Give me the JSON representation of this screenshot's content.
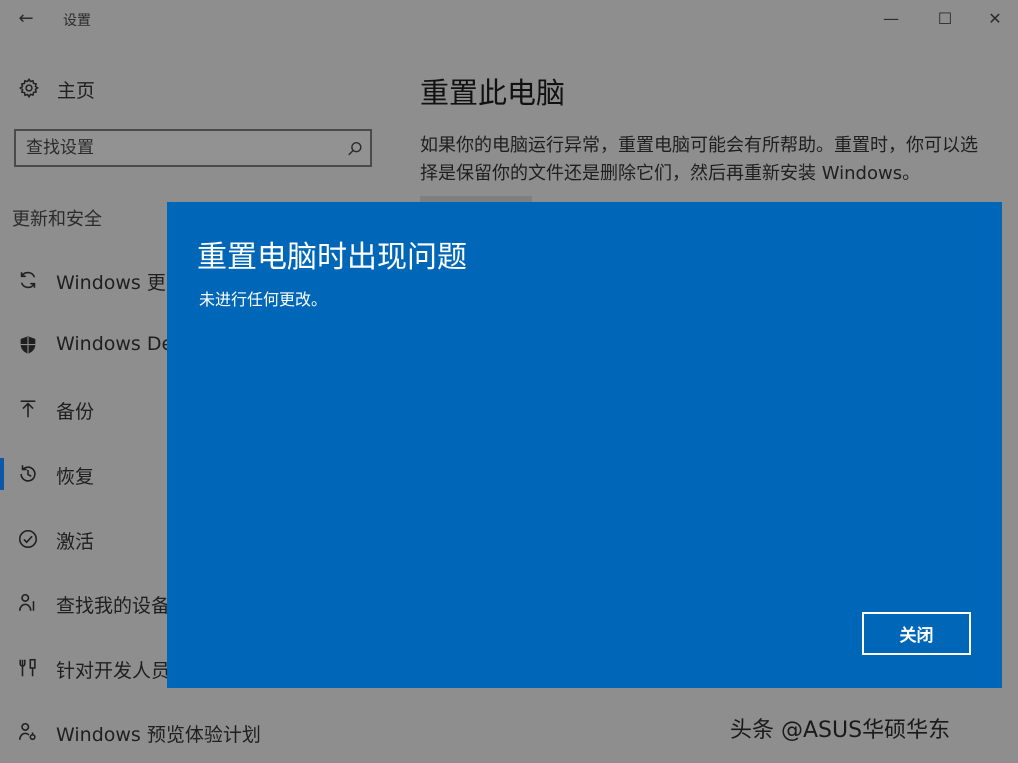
{
  "window": {
    "title": "设置",
    "back_glyph": "←",
    "controls": {
      "minimize": "—",
      "maximize": "☐",
      "close": "✕"
    }
  },
  "sidebar": {
    "home_label": "主页",
    "search": {
      "placeholder": "查找设置"
    },
    "section_heading": "更新和安全",
    "items": [
      {
        "label": "Windows 更",
        "icon": "refresh-icon"
      },
      {
        "label": "Windows De",
        "icon": "shield-icon"
      },
      {
        "label": "备份",
        "icon": "backup-arrow-icon"
      },
      {
        "label": "恢复",
        "icon": "history-icon",
        "active": true
      },
      {
        "label": "激活",
        "icon": "check-circle-icon"
      },
      {
        "label": "查找我的设备",
        "icon": "person-pin-icon"
      },
      {
        "label": "针对开发人员",
        "icon": "developer-tools-icon"
      },
      {
        "label": "Windows 预览体验计划",
        "icon": "insider-person-icon"
      }
    ]
  },
  "content": {
    "title": "重置此电脑",
    "description": "如果你的电脑运行异常，重置电脑可能会有所帮助。重置时，你可以选择是保留你的文件还是删除它们，然后再重新安装 Windows。"
  },
  "dialog": {
    "title": "重置电脑时出现问题",
    "message": "未进行任何更改。",
    "close_label": "关闭"
  },
  "watermark": "头条 @ASUS华硕华东",
  "colors": {
    "dialog_background": "#0067b8",
    "overlay_gray": "#8e8e8e",
    "accent": "#0b57a8"
  }
}
